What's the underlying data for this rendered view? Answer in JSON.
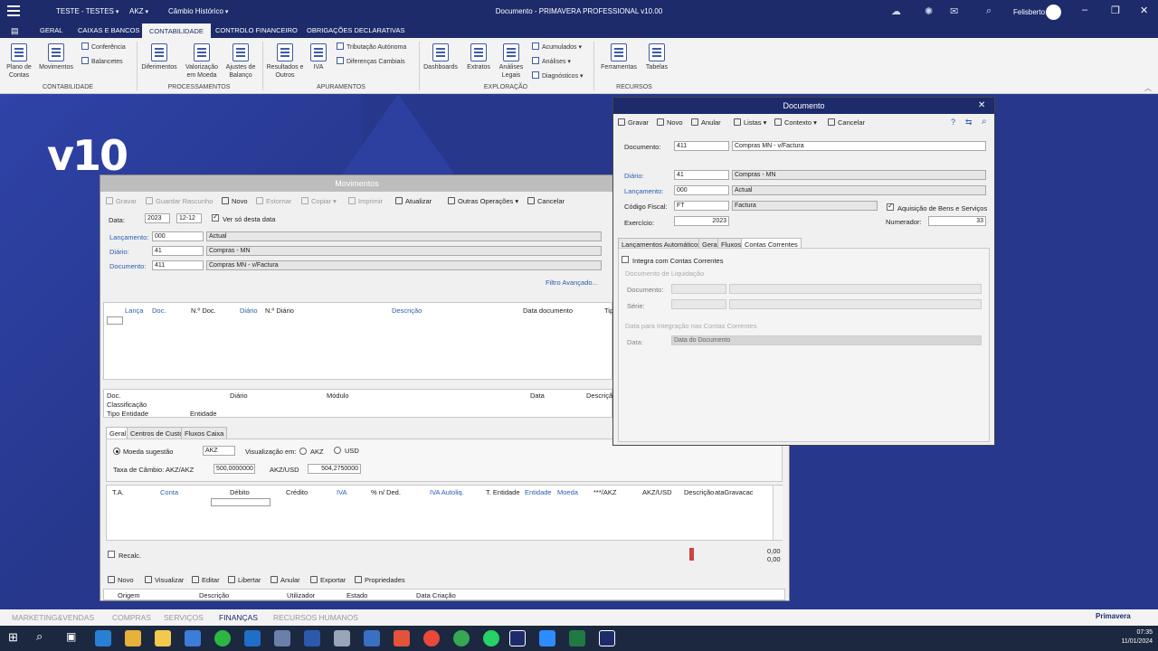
{
  "titlebar": {
    "company": "TESTE - TESTES",
    "currency": "AKZ",
    "exchange": "Câmbio Histórico",
    "title": "Documento - PRIMAVERA PROFESSIONAL v10.00",
    "user": "Felisberto"
  },
  "menu_tabs": [
    "GERAL",
    "CAIXAS E BANCOS",
    "CONTABILIDADE",
    "CONTROLO FINANCEIRO",
    "OBRIGAÇÕES DECLARATIVAS"
  ],
  "ribbon": {
    "plano_contas": "Plano de Contas",
    "movimentos": "Movimentos",
    "conferencia": "Conferência",
    "balancetes": "Balancetes",
    "group_contabilidade": "CONTABILIDADE",
    "diferimentos": "Diferimentos",
    "valorizacao": "Valorização em Moeda",
    "ajustes": "Ajustes de Balanço",
    "group_processamentos": "PROCESSAMENTOS",
    "resultados": "Resultados e Outros",
    "iva": "IVA",
    "tributacao": "Tributação Autónoma",
    "diferencas": "Diferenças Cambiais",
    "group_apuramentos": "APURAMENTOS",
    "dashboards": "Dashboards",
    "extratos": "Extratos",
    "analises_legais": "Análises Legais",
    "acumulados": "Acumulados",
    "analises": "Análises",
    "diagnosticos": "Diagnósticos",
    "group_exploracao": "EXPLORAÇÃO",
    "ferramentas": "Ferramentas",
    "tabelas": "Tabelas",
    "group_recursos": "RECURSOS"
  },
  "brand": "v10",
  "movimentos": {
    "title": "Movimentos",
    "toolbar": {
      "gravar": "Gravar",
      "guardar": "Guardar Rascunho",
      "novo": "Novo",
      "estornar": "Estornar",
      "copiar": "Copiar",
      "imprimir": "Imprimir",
      "atualizar": "Atualizar",
      "outras": "Outras Operações",
      "cancelar": "Cancelar"
    },
    "data_label": "Data:",
    "data_year": "2023",
    "data_day": "12-12",
    "ver_so": "Ver só desta data",
    "lancamento_label": "Lançamento:",
    "lancamento_code": "000",
    "lancamento_desc": "Actual",
    "diario_label": "Diário:",
    "diario_code": "41",
    "diario_desc": "Compras - MN",
    "documento_label": "Documento:",
    "documento_code": "411",
    "documento_desc": "Compras MN - v/Factura",
    "filtro": "Filtro Avançado...",
    "grid_headers": {
      "lanca": "Lança",
      "doc": "Doc.",
      "ndoc": "N.º Doc.",
      "diario": "Diário",
      "ndiario": "N.º Diário",
      "descricao": "Descrição",
      "data_doc": "Data documento",
      "tipo": "Tipo"
    },
    "detail": {
      "doc": "Doc.",
      "diario": "Diário",
      "modulo": "Módulo",
      "data": "Data",
      "descricao": "Descriçã",
      "classificacao": "Classificação",
      "tipo_entidade": "Tipo Entidade",
      "entidade": "Entidade"
    },
    "tabs": [
      "Geral",
      "Centros de Custo",
      "Fluxos Caixa"
    ],
    "moeda_sugestao": "Moeda sugestão",
    "moeda": "AKZ",
    "visualizacao": "Visualização em:",
    "opt_akz": "AKZ",
    "opt_usd": "USD",
    "taxa_label": "Taxa de Câmbio:",
    "akz_akz_label": "AKZ/AKZ",
    "akz_akz_value": "500,0000000",
    "akz_usd_label": "AKZ/USD",
    "akz_usd_value": "504,2750000",
    "lines_headers": {
      "ta": "T.A.",
      "conta": "Conta",
      "debito": "Débito",
      "credito": "Crédito",
      "iva": "IVA",
      "ded": "% n/ Ded.",
      "iva_auto": "IVA Autoliq.",
      "t_entidade": "T. Entidade",
      "entidade": "Entidade",
      "moeda": "Moeda",
      "akz": "***/AKZ",
      "akz_usd": "AKZ/USD",
      "descricao": "Descrição",
      "data_grav": "ataGravacac"
    },
    "recalc": "Recalc.",
    "total1": "0,00",
    "total2": "0,00",
    "bottom_toolbar": {
      "novo": "Novo",
      "visualizar": "Visualizar",
      "editar": "Editar",
      "libertar": "Libertar",
      "anular": "Anular",
      "exportar": "Exportar",
      "propriedades": "Propriedades"
    },
    "footer_headers": {
      "origem": "Origem",
      "descricao": "Descrição",
      "utilizador": "Utilizador",
      "estado": "Estado",
      "data_criacao": "Data Criação"
    }
  },
  "documento": {
    "title": "Documento",
    "toolbar": {
      "gravar": "Gravar",
      "novo": "Novo",
      "anular": "Anular",
      "listas": "Listas",
      "contexto": "Contexto",
      "cancelar": "Cancelar"
    },
    "documento_label": "Documento:",
    "documento_code": "411",
    "documento_desc": "Compras MN - v/Factura",
    "diario_label": "Diário:",
    "diario_code": "41",
    "diario_desc": "Compras - MN",
    "lancamento_label": "Lançamento:",
    "lancamento_code": "000",
    "lancamento_desc": "Actual",
    "codigo_fiscal_label": "Código Fiscal:",
    "codigo_fiscal_code": "FT",
    "codigo_fiscal_desc": "Factura",
    "aquisicao": "Aquisição de Bens e Serviços",
    "exercicio_label": "Exercício:",
    "exercicio": "2023",
    "numerador_label": "Numerador:",
    "numerador": "33",
    "tabs": [
      "Lançamentos Automáticos",
      "Geral",
      "Fluxos",
      "Contas Correntes"
    ],
    "integra": "Integra com Contas Correntes",
    "doc_liquidacao": "Documento de Liquidação",
    "documento2_label": "Documento:",
    "serie_label": "Série:",
    "data_integracao": "Data para Integração nas Contas Correntes",
    "data_label": "Data:",
    "data_value": "Data do Documento"
  },
  "bottom_tabs": [
    "MARKETING&VENDAS",
    "COMPRAS",
    "SERVIÇOS",
    "FINANÇAS",
    "RECURSOS HUMANOS"
  ],
  "primavera": "Primavera",
  "clock": {
    "time": "07:35",
    "date": "11/01/2024"
  }
}
